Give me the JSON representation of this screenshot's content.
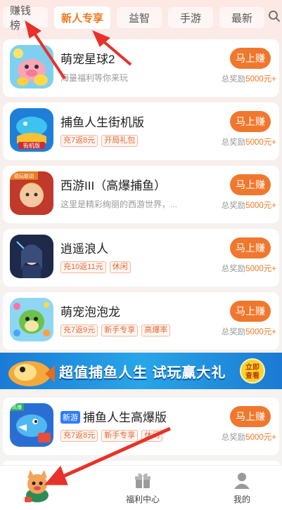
{
  "tabs": [
    {
      "label": "赚钱榜"
    },
    {
      "label": "新人专享",
      "active": true
    },
    {
      "label": "益智"
    },
    {
      "label": "手游"
    },
    {
      "label": "最新"
    }
  ],
  "games": [
    {
      "title": "萌宠星球2",
      "desc": "海量福利等你来玩",
      "tags": [],
      "button": "马上赚",
      "reward_prefix": "总奖励",
      "reward_amount": "5000元+"
    },
    {
      "title": "捕鱼人生街机版",
      "tags": [
        "充7返8元",
        "开局礼包"
      ],
      "button": "马上赚",
      "reward_prefix": "总奖励",
      "reward_amount": "5000元+"
    },
    {
      "title": "西游III（高爆捕鱼）",
      "desc": "这里是精彩绚丽的西游世界，...",
      "tags": [],
      "button": "马上赚",
      "reward_prefix": "总奖励",
      "reward_amount": "5000元+"
    },
    {
      "title": "逍遥浪人",
      "tags": [
        "充10返11元",
        "休闲"
      ],
      "button": "马上赚",
      "reward_prefix": "总奖励",
      "reward_amount": "5000元+"
    },
    {
      "title": "萌宠泡泡龙",
      "tags": [
        "充7返9元",
        "新手专享",
        "高爆率"
      ],
      "button": "马上赚",
      "reward_prefix": "总奖励",
      "reward_amount": "5000元+"
    },
    {
      "title": "捕鱼人生高爆版",
      "badge": "新游",
      "tags": [
        "充7返8元",
        "新手专享",
        "休闲"
      ],
      "button": "马上赚",
      "reward_prefix": "总奖励",
      "reward_amount": "5000元+"
    }
  ],
  "banner": {
    "text": "超值捕鱼人生 试玩赢大礼",
    "button_line1": "立即",
    "button_line2": "查看"
  },
  "icon_labels": {
    "game3": "德玩联动",
    "game2": "街机版",
    "game6": "高爆"
  },
  "bottom_nav": [
    {
      "label": "",
      "icon": "mascot-icon"
    },
    {
      "label": "福利中心",
      "icon": "gift-icon"
    },
    {
      "label": "我的",
      "icon": "user-icon"
    }
  ],
  "colors": {
    "accent": "#f0782e",
    "tag_text": "#e06a3b",
    "annotation": "#e8312a"
  }
}
